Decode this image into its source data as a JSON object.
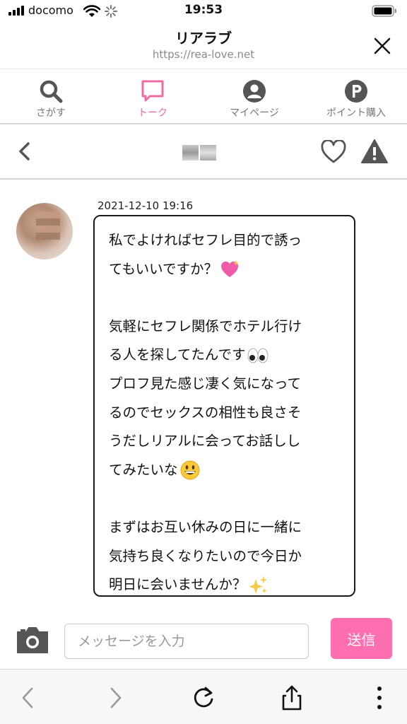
{
  "status_bar": {
    "carrier": "docomo",
    "time": "19:53"
  },
  "browser": {
    "title": "リアラブ",
    "url": "https://rea-love.net"
  },
  "tabs": [
    {
      "label": "さがす",
      "icon": "search-icon"
    },
    {
      "label": "トーク",
      "icon": "chat-bubble-icon",
      "active": true
    },
    {
      "label": "マイページ",
      "icon": "person-icon"
    },
    {
      "label": "ポイント購入",
      "icon": "point-icon"
    }
  ],
  "chat": {
    "timestamp": "2021-12-10 19:16",
    "message_lines": [
      "私でよければセフレ目的で誘っ",
      "てもいいですか？",
      "",
      "気軽にセフレ関係でホテル行け",
      "る人を探してたんです",
      "プロフ見た感じ凄く気になって",
      "るのでセックスの相性も良さそ",
      "うだしリアルに会ってお話しし",
      "てみたいな",
      "",
      "まずはお互い休みの日に一緒に",
      "気持ち良くなりたいので今日か",
      "明日に会いませんか？"
    ]
  },
  "composer": {
    "placeholder": "メッセージを入力",
    "send_label": "送信"
  },
  "colors": {
    "accent": "#ef6ba4",
    "send_button": "#ff6fb0",
    "icon_gray": "#555555"
  }
}
